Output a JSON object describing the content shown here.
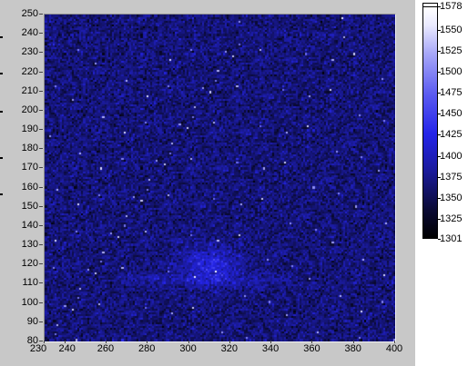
{
  "window": {
    "title": ""
  },
  "chart_data": {
    "type": "heatmap",
    "title": "",
    "xlabel": "",
    "ylabel": "",
    "xlim": [
      230,
      400
    ],
    "ylim": [
      80,
      250
    ],
    "x_ticks": [
      "230",
      "240",
      "260",
      "280",
      "300",
      "320",
      "340",
      "360",
      "380",
      "400"
    ],
    "y_ticks": [
      "250",
      "240",
      "230",
      "220",
      "210",
      "200",
      "190",
      "180",
      "170",
      "160",
      "150",
      "140",
      "130",
      "120",
      "110",
      "100",
      "90",
      "80"
    ],
    "colorscale": {
      "min": 1301,
      "max": 1578,
      "ticks": [
        "1578",
        "1550",
        "1525",
        "1500",
        "1475",
        "1450",
        "1425",
        "1400",
        "1375",
        "1350",
        "1325",
        "1301"
      ],
      "colors": [
        "#000000",
        "#1b1ba0",
        "#2424e8",
        "#5a5af0",
        "#a8a8f8",
        "#ffffff"
      ]
    },
    "background_level": 1365,
    "noise_level": 18,
    "features": [
      {
        "name": "bright spot",
        "x": 310,
        "y": 120,
        "peak": 1420,
        "radius_x": 14,
        "radius_y": 10
      },
      {
        "name": "faint band",
        "x_start": 270,
        "x_end": 350,
        "y": 112,
        "peak": 1385
      }
    ]
  }
}
